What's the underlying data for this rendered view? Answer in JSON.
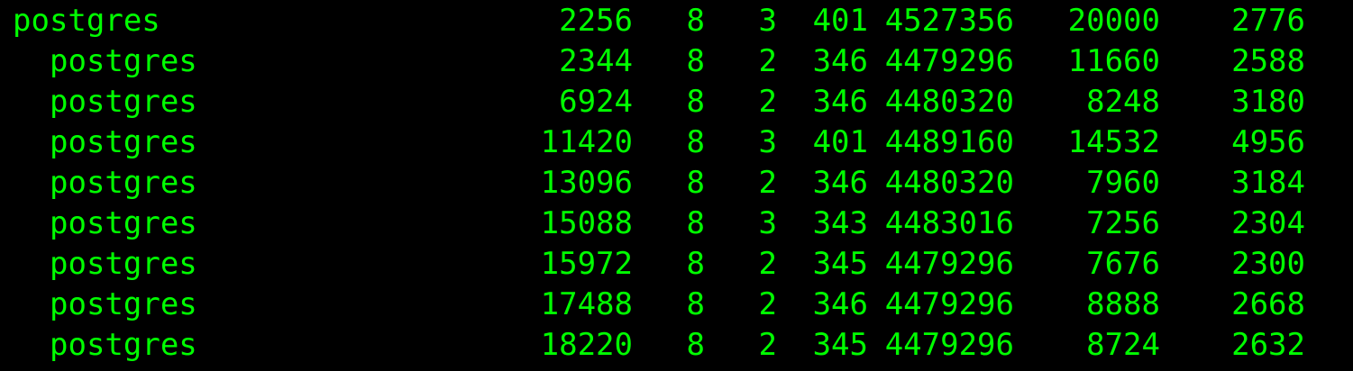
{
  "terminal": {
    "foreground": "#00ff00",
    "background": "#000000",
    "rows": [
      {
        "name": "postgres",
        "pid": "2256",
        "col2": "8",
        "col3": "3",
        "col4": "401",
        "col5": "4527356",
        "col6": "20000",
        "col7": "2776"
      },
      {
        "name": "postgres",
        "pid": "2344",
        "col2": "8",
        "col3": "2",
        "col4": "346",
        "col5": "4479296",
        "col6": "11660",
        "col7": "2588"
      },
      {
        "name": "postgres",
        "pid": "6924",
        "col2": "8",
        "col3": "2",
        "col4": "346",
        "col5": "4480320",
        "col6": "8248",
        "col7": "3180"
      },
      {
        "name": "postgres",
        "pid": "11420",
        "col2": "8",
        "col3": "3",
        "col4": "401",
        "col5": "4489160",
        "col6": "14532",
        "col7": "4956"
      },
      {
        "name": "postgres",
        "pid": "13096",
        "col2": "8",
        "col3": "2",
        "col4": "346",
        "col5": "4480320",
        "col6": "7960",
        "col7": "3184"
      },
      {
        "name": "postgres",
        "pid": "15088",
        "col2": "8",
        "col3": "3",
        "col4": "343",
        "col5": "4483016",
        "col6": "7256",
        "col7": "2304"
      },
      {
        "name": "postgres",
        "pid": "15972",
        "col2": "8",
        "col3": "2",
        "col4": "345",
        "col5": "4479296",
        "col6": "7676",
        "col7": "2300"
      },
      {
        "name": "postgres",
        "pid": "17488",
        "col2": "8",
        "col3": "2",
        "col4": "346",
        "col5": "4479296",
        "col6": "8888",
        "col7": "2668"
      },
      {
        "name": "postgres",
        "pid": "18220",
        "col2": "8",
        "col3": "2",
        "col4": "345",
        "col5": "4479296",
        "col6": "8724",
        "col7": "2632"
      }
    ]
  }
}
